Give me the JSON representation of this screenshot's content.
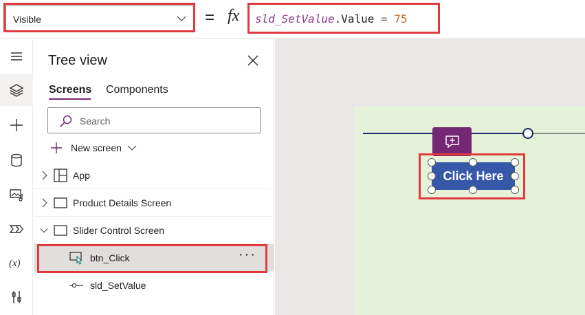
{
  "formula_bar": {
    "property": "Visible",
    "equals": "=",
    "fx": "fx",
    "formula": {
      "control": "sld_SetValue",
      "property": ".Value",
      "operator": " = ",
      "value": "75"
    }
  },
  "left_rail": {
    "items": [
      {
        "icon": "hamburger-menu-icon"
      },
      {
        "icon": "layers-icon",
        "active": true
      },
      {
        "icon": "plus-icon"
      },
      {
        "icon": "database-icon"
      },
      {
        "icon": "media-icon"
      },
      {
        "icon": "power-automate-icon"
      },
      {
        "icon": "variables-icon",
        "label": "(x)"
      },
      {
        "icon": "tools-icon"
      }
    ]
  },
  "tree_view": {
    "title": "Tree view",
    "tabs": [
      {
        "label": "Screens",
        "active": true
      },
      {
        "label": "Components",
        "active": false
      }
    ],
    "search_placeholder": "Search",
    "new_screen_label": "New screen",
    "rows": [
      {
        "label": "App",
        "icon": "app-grid-icon",
        "level": 0,
        "expanded": false
      },
      {
        "label": "Product Details Screen",
        "icon": "screen-icon",
        "level": 0,
        "expanded": false
      },
      {
        "label": "Slider Control Screen",
        "icon": "screen-icon",
        "level": 0,
        "expanded": true
      },
      {
        "label": "btn_Click",
        "icon": "button-control-icon",
        "level": 1,
        "selected": true,
        "more": "···"
      },
      {
        "label": "sld_SetValue",
        "icon": "slider-control-icon",
        "level": 1
      }
    ]
  },
  "canvas": {
    "button_label": "Click Here",
    "slider_value": 75
  },
  "colors": {
    "accent_purple": "#742774",
    "button_blue": "#3559a8",
    "highlight_red": "#e0393e",
    "screen_bg": "#e5f2d9"
  }
}
